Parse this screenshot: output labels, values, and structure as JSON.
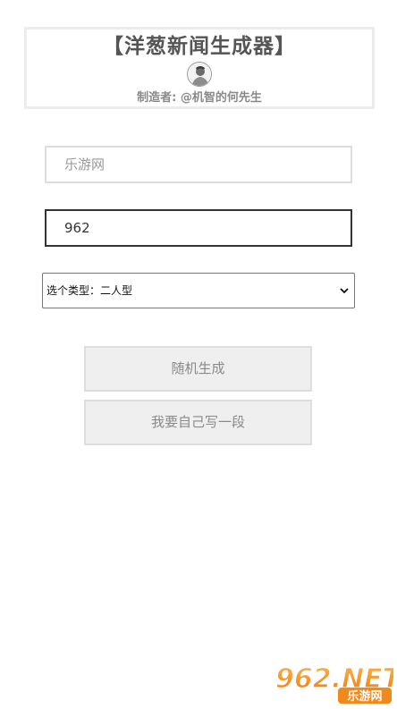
{
  "header": {
    "title": "【洋葱新闻生成器】",
    "maker": "制造者: @机智的何先生"
  },
  "form": {
    "source_placeholder": "乐游网",
    "name_value": "962",
    "type_select_value": "选个类型：二人型"
  },
  "buttons": {
    "random_label": "随机生成",
    "custom_label": "我要自己写一段"
  },
  "watermark": {
    "logo_text": "962.NET",
    "sub_text": "乐游网"
  },
  "colors": {
    "title": "#555555",
    "card_border": "#ececec",
    "button_bg": "#efefef",
    "button_text": "#8a8a8a",
    "watermark_orange": "#f08a1c"
  }
}
